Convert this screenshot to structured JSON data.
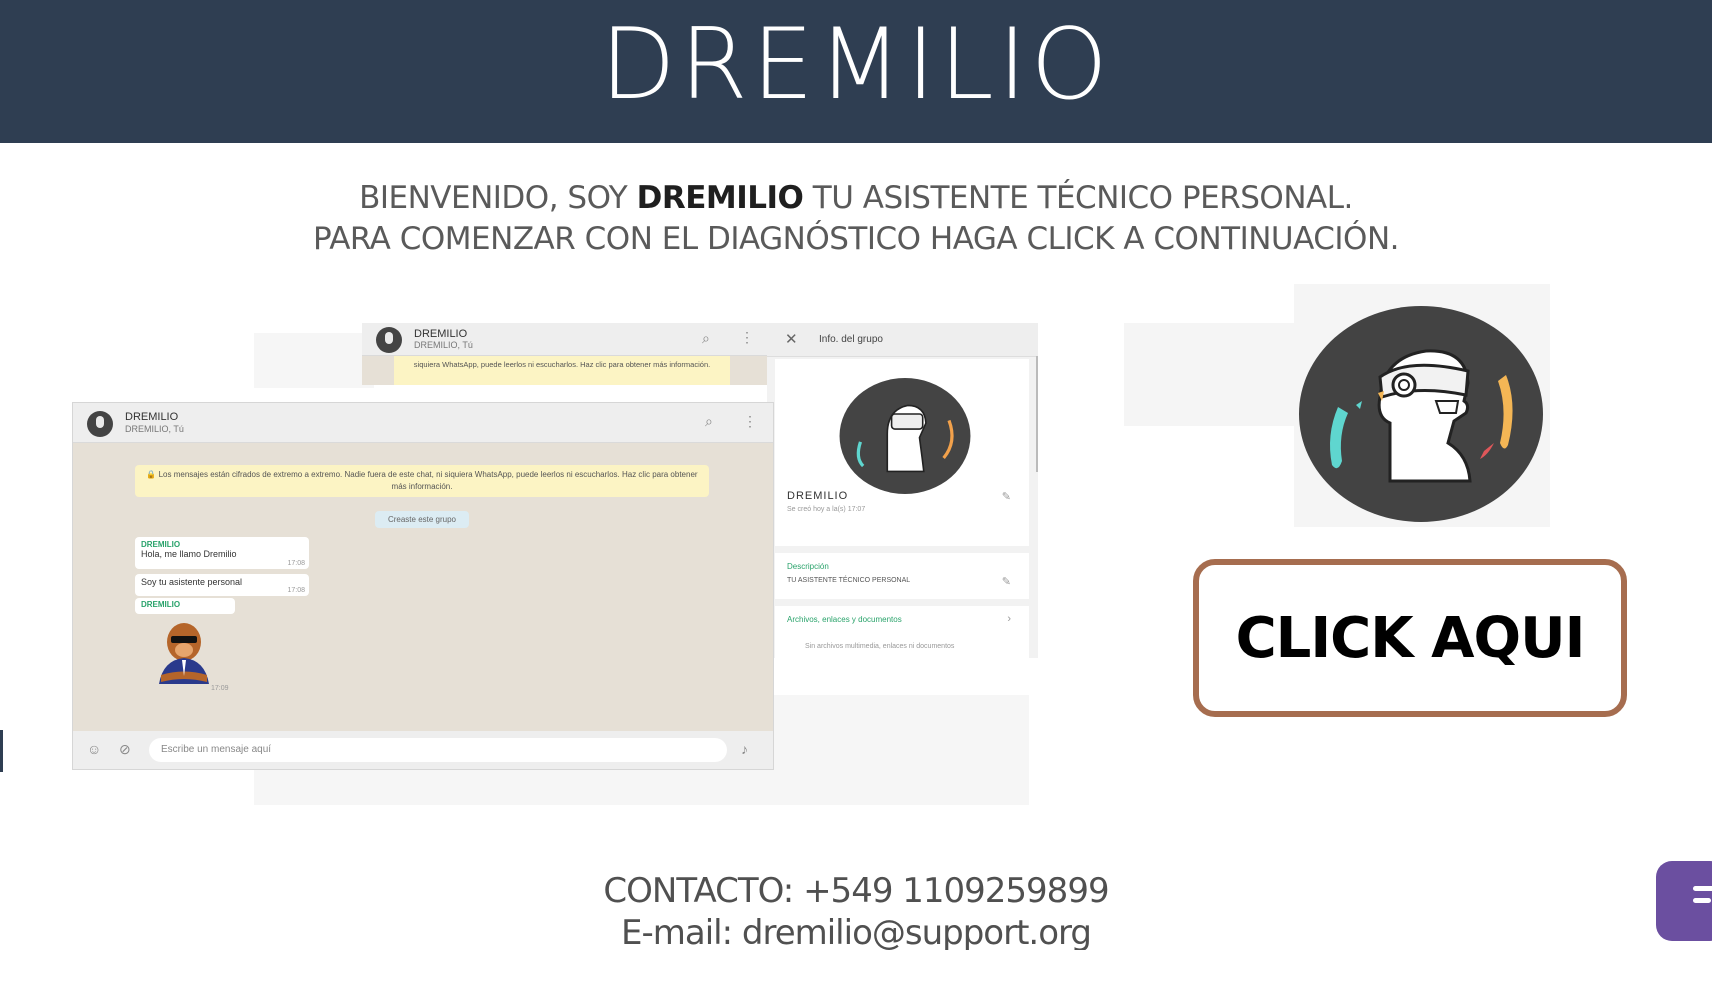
{
  "header": {
    "title": "DREMILIO"
  },
  "welcome": {
    "line1_pre": "BIENVENIDO, SOY ",
    "line1_name": "DREMILIO",
    "line1_post": " TU ASISTENTE TÉCNICO PERSONAL.",
    "line2": "PARA COMENZAR CON EL DIAGNÓSTICO HAGA CLICK A CONTINUACIÓN."
  },
  "whatsapp": {
    "chat_name": "DREMILIO",
    "chat_sub": "DREMILIO, Tú",
    "notice": "🔒 Los mensajes están cifrados de extremo a extremo. Nadie fuera de este chat, ni siquiera WhatsApp, puede leerlos ni escucharlos. Haz clic para obtener más información.",
    "top_notice": "siquiera WhatsApp, puede leerlos ni escucharlos. Haz clic para obtener más información.",
    "created": "Creaste este grupo",
    "messages": [
      {
        "sender": "DREMILIO",
        "text": "Hola, me llamo Dremilio",
        "time": "17:08"
      },
      {
        "sender": "",
        "text": "Soy tu asistente personal",
        "time": "17:08"
      },
      {
        "sender": "DREMILIO",
        "text": "",
        "time": "17:09"
      }
    ],
    "input_placeholder": "Escribe un mensaje aquí",
    "info": {
      "title": "Info. del grupo",
      "group_name": "DREMILIO",
      "created_text": "Se creó hoy a la(s) 17:07",
      "description_label": "Descripción",
      "description": "TU ASISTENTE TÉCNICO PERSONAL",
      "files_label": "Archivos, enlaces y documentos",
      "files_empty": "Sin archivos multimedia, enlaces ni documentos"
    }
  },
  "cta": {
    "label": "CLICK AQUI"
  },
  "contact": {
    "phone": "CONTACTO: +549 1109259899",
    "email": "E-mail: dremilio@support.org"
  },
  "colors": {
    "header_bg": "#2f3e52",
    "button_border": "#a66d4f",
    "widget": "#6b4fa0"
  }
}
